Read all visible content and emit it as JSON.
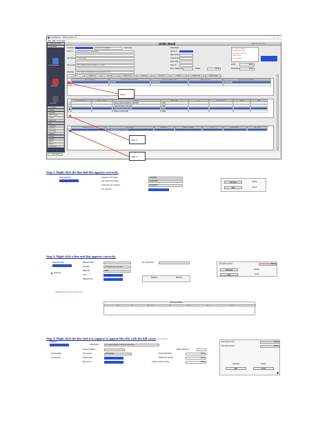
{
  "app": {
    "title": "CoordMaster - VBS Honolulu, Inc",
    "menu": [
      "File",
      "Edit",
      "Tools",
      "Help"
    ],
    "form_title": "Order Book",
    "status_text": "Bill Held Included",
    "footer_tab": "Order Book"
  },
  "sidebar": {
    "top_items": [
      "Coordinator Home",
      "Order Book"
    ],
    "icon_labels": [
      "Create Quotation",
      "Order Book",
      "Balance",
      "Receivable"
    ],
    "list_items": [
      "Customers",
      "Contacts",
      "Inventory",
      "Work Orders",
      "Orders",
      "Order Log",
      "BPA",
      "Commons",
      "Inventory",
      "Receiving",
      "Shipping",
      "Invoices",
      "Reports",
      "Admin",
      "Search",
      "Dashboard"
    ]
  },
  "header_form": {
    "labels": {
      "customer": "Customer",
      "sold_to": "Sold To",
      "address": "",
      "job_name": "Job Name",
      "job_location": "Job Location",
      "engineer": "Engineer",
      "coord_rep": "Coord Rep",
      "date_field": "Date Build",
      "quote_no": "Quote #",
      "date_order": "Date Order",
      "total_amount": "Total Amount",
      "date_ship": "Date Ship",
      "ship_to": "Ship To",
      "emp_salesman": "Emp. Salesman",
      "initials": "Initials",
      "profit": "Profit",
      "total_paid": "Total Paid"
    },
    "values": {
      "customer": "",
      "sold_to": "Primo Subcontractors",
      "address": "Coll Mechanical Inc. (ID+5920)",
      "job_name": "1 / 123 Street",
      "job_location": "8701 Jackson Avenue Bravo, NY 10408",
      "engineer": "NYC School Construction Authority (ID+22-1007)",
      "coord_rep": "Coordinator Smith",
      "date_field": "",
      "quote_no": "",
      "total_amount": "$0.00",
      "profit": "$0.00",
      "total_paid": "$0.00"
    },
    "notes": [
      "Sr. Job Tax Exempt",
      "Tax/Resale On File",
      "Tax Exempt Cert. P.O.",
      "Field & Hold",
      "Job Complete"
    ]
  },
  "tabs": [
    "Orders",
    "Suppl. PO",
    "Mt. Bill",
    "Check Hist",
    "Cust PO",
    "Sub Bill",
    "Tax Ex",
    "Private Cert",
    "Setting Log"
  ],
  "orders_grid": {
    "headers": [
      "Order Number",
      "Customer P.O. Number",
      "Customer P.O. Date",
      "P.O. Amount",
      "Our Order Entry Date"
    ],
    "rows": [
      [
        "",
        "2/14/20",
        "01/09/2020",
        "",
        "01/09/2020"
      ],
      [
        "",
        "",
        "",
        "",
        ""
      ]
    ]
  },
  "details_grid": {
    "headers": [
      "Detail Number",
      "Release Date",
      "Supplier",
      "Billed By",
      "Cost",
      "Selling Price",
      "Profit",
      "Bill"
    ],
    "rows": [
      [
        "",
        "",
        "Havens Sheet Metal Inc. (ID+995)",
        "SRS",
        "",
        "",
        "",
        ""
      ],
      [
        "",
        "",
        "United Enertech (ID+101)",
        "SRS",
        "",
        "",
        "",
        ""
      ],
      [
        "",
        "",
        "United Enertech (ID+101)",
        "SRS",
        "",
        "",
        "",
        ""
      ],
      [
        "",
        "",
        "Motion AI (ID+1114)",
        "SRS",
        "",
        "",
        "",
        ""
      ]
    ]
  },
  "parts_grid": {
    "headers": [
      "Partial Number",
      "Description",
      "Proforma",
      "Process With",
      "Cost",
      "Selling Price",
      "Mr. Com"
    ],
    "rows": [
      [
        "",
        "31 United Enertech Louvered",
        "",
        "",
        "",
        "",
        ""
      ]
    ]
  },
  "callouts": [
    "Step 1",
    "Step 2",
    "Step 3"
  ],
  "step1": {
    "heading": "Step 1: Right click the line and this appears correctly.",
    "labels": [
      "Order Number:",
      "Customer P.O. Date:",
      "Our Order Entry Date:",
      "Customer P.O. Number:",
      "P.O. Amount:"
    ],
    "values": [
      "2/14/2020",
      "01/09/2020",
      "01/09/2020",
      "",
      ""
    ],
    "buttons": [
      "Add New",
      "Delete",
      "Edit",
      "Close"
    ]
  },
  "step2": {
    "heading": "Step 2: Right click a line and this appears correctly.",
    "labels": [
      "Detail Number:",
      "Release Date:",
      "Est. Ship Date:",
      "Supplier:",
      "Billed By:",
      "Cost:",
      "Selling Price:",
      "Approver",
      "Remaining Price:"
    ],
    "values": [
      "",
      "",
      "",
      "United Enertech (ID+101)",
      "SRS",
      "",
      "",
      "",
      "$0.00"
    ],
    "balance_labels": [
      "Balance",
      "Bal Due"
    ],
    "notification": "Notification Email was not sent yet",
    "buttons": [
      "Add New",
      "Delete",
      "Edit",
      "Close"
    ],
    "submittal_title": "Submittal Status",
    "submittal_headers": [
      "Sent",
      "Received",
      "Status",
      "Notes"
    ]
  },
  "step3": {
    "heading": "Step 3: Right click the line and it is suppose to appear like this with the full cover.",
    "labels": [
      "Partial #:",
      "Description:",
      "Havens SalesP:",
      "Tax County:",
      "Partial Cost:",
      "Mfr Comm:",
      "Old Tax Rate:",
      "Tax Exempt:",
      "Back Charge %:",
      "Partial Sell Price:",
      "Partial Tax (5.0%):",
      "Credit Card Fee (3%):",
      "Remaining Cost:",
      "Remaining Price:",
      "Take From Inventory"
    ],
    "values": [
      "",
      "31 United Enertech Louvered Penthouse",
      "",
      "Tax Exempt",
      "",
      "",
      "",
      "",
      "",
      "$0.00",
      "$0.00",
      "$0.00",
      "$0.00",
      "$0.00",
      ""
    ],
    "buttons": [
      "Add New",
      "Delete",
      "Edit",
      "Close"
    ]
  },
  "colors": {
    "selection_blue": "#1b58c8",
    "redaction_blue": "#2a4fd6",
    "arrow_red": "#d21f1f",
    "nav_dark": "#3a3f55"
  }
}
